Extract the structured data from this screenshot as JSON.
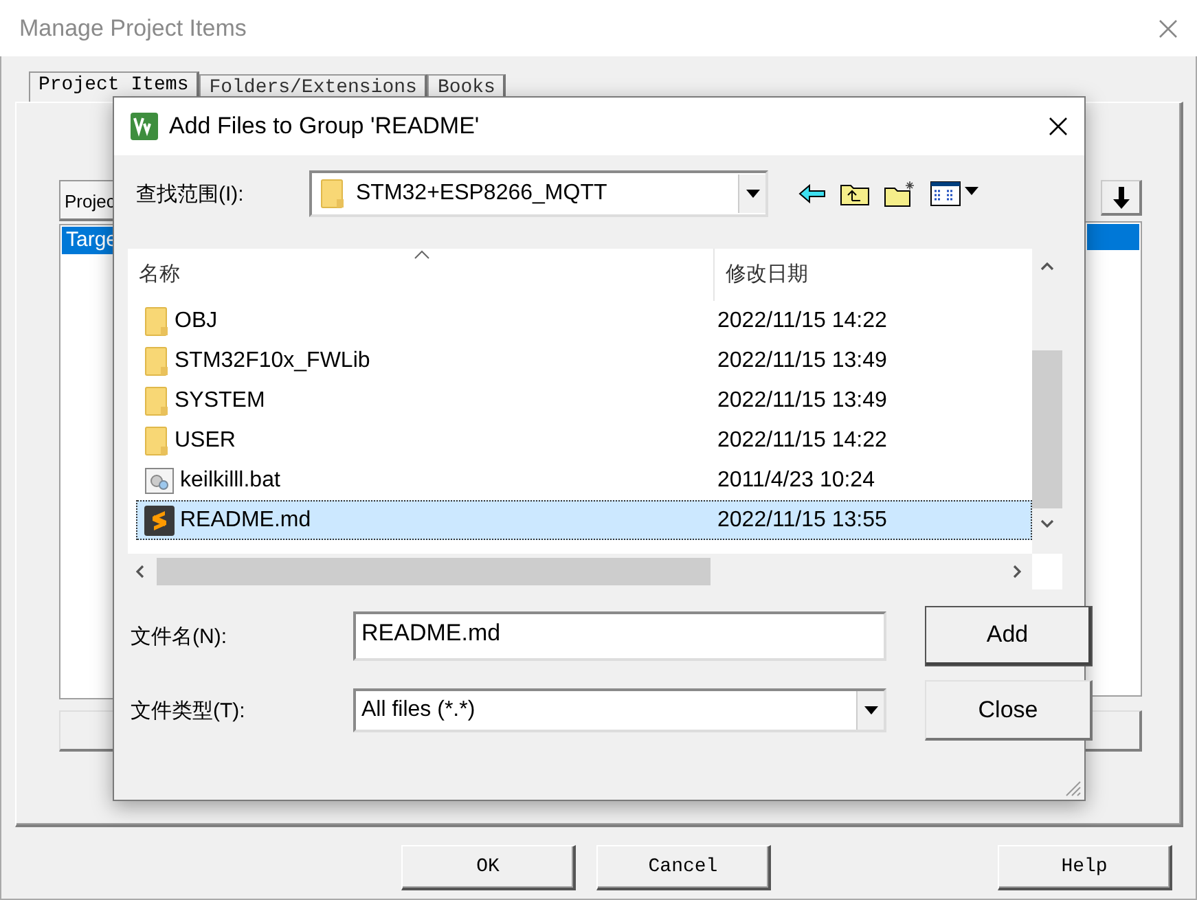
{
  "window": {
    "title": "Manage Project Items"
  },
  "tabs": [
    {
      "label": "Project Items",
      "selected": true
    },
    {
      "label": "Folders/Extensions",
      "selected": false
    },
    {
      "label": "Books",
      "selected": false
    }
  ],
  "project_panel": {
    "header": "Projec",
    "items": [
      {
        "label": "Targe",
        "selected": true
      }
    ]
  },
  "files_panel": {
    "items": [
      {
        "selected": true
      }
    ]
  },
  "buttons": [
    {
      "label": "OK"
    },
    {
      "label": "Cancel"
    },
    {
      "label": "Help"
    }
  ],
  "dialog": {
    "title": "Add Files to Group 'README'",
    "look_in_label": "查找范围(I):",
    "look_in_value": "STM32+ESP8266_MQTT",
    "columns": [
      "名称",
      "修改日期"
    ],
    "files": [
      {
        "name": "OBJ",
        "date": "2022/11/15 14:22",
        "kind": "folder",
        "selected": false
      },
      {
        "name": "STM32F10x_FWLib",
        "date": "2022/11/15 13:49",
        "kind": "folder",
        "selected": false
      },
      {
        "name": "SYSTEM",
        "date": "2022/11/15 13:49",
        "kind": "folder",
        "selected": false
      },
      {
        "name": "USER",
        "date": "2022/11/15 14:22",
        "kind": "folder",
        "selected": false
      },
      {
        "name": "keilkilll.bat",
        "date": "2011/4/23 10:24",
        "kind": "batch",
        "selected": false
      },
      {
        "name": "README.md",
        "date": "2022/11/15 13:55",
        "kind": "markdown",
        "selected": true
      }
    ],
    "file_name_label": "文件名(N):",
    "file_name": "README.md",
    "file_type_label": "文件类型(T):",
    "file_type": "All files (*.*)",
    "buttons": [
      {
        "label": "Add",
        "default": true
      },
      {
        "label": "Close",
        "default": false
      }
    ]
  }
}
